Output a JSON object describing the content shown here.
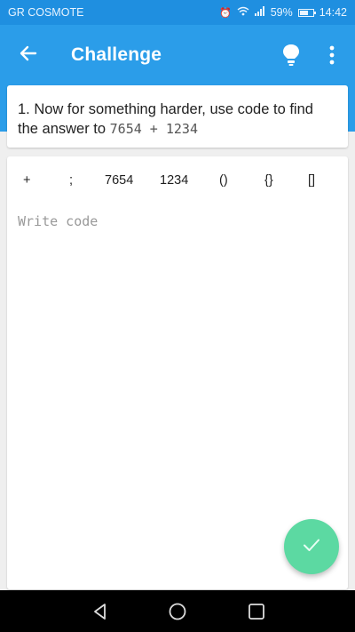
{
  "status_bar": {
    "carrier": "GR COSMOTE",
    "battery": "59%",
    "time": "14:42",
    "icons": [
      "alarm-icon",
      "wifi-icon",
      "signal-icon",
      "battery-icon"
    ]
  },
  "app_bar": {
    "title": "Challenge",
    "back_icon": "arrow-left-icon",
    "hint_icon": "lightbulb-icon",
    "menu_icon": "more-vert-icon"
  },
  "question": {
    "text": "1. Now for something harder, use code to find the answer to ",
    "code": "7654 + 1234"
  },
  "snippet_chips": [
    "+",
    ";",
    "7654",
    "1234",
    "()",
    "{}",
    "[]"
  ],
  "editor": {
    "placeholder": "Write code",
    "value": ""
  },
  "submit": {
    "icon": "check-icon"
  },
  "nav_bar": {
    "icons": [
      "back-triangle-icon",
      "home-circle-icon",
      "recents-square-icon"
    ]
  },
  "colors": {
    "primary": "#2b9de9",
    "status": "#1f8fe0",
    "fab": "#5cd9a2"
  }
}
